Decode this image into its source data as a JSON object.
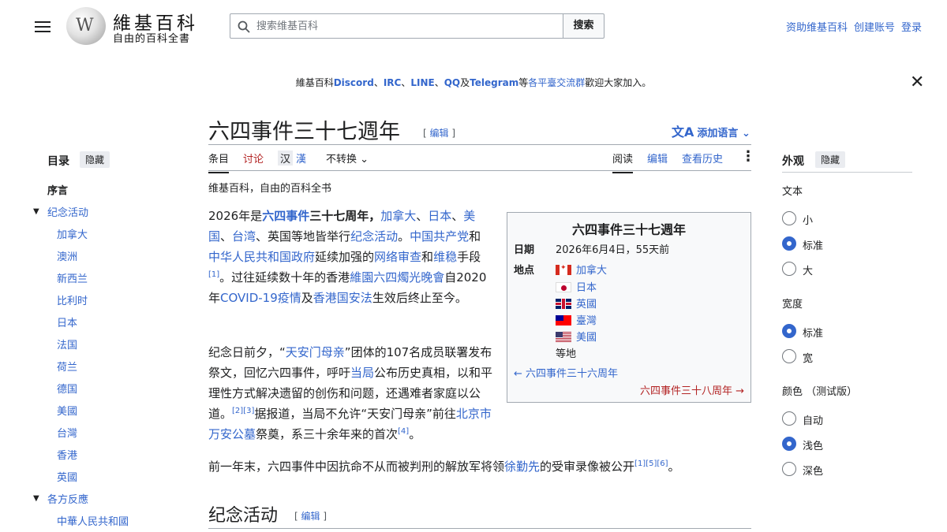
{
  "header": {
    "wordmark": "維基百科",
    "tagline": "自由的百科全書",
    "search_placeholder": "搜索维基百科",
    "search_button": "搜索",
    "user_links": [
      "资助维基百科",
      "创建账号",
      "登录"
    ]
  },
  "banner": {
    "prefix": "維基百科",
    "links": [
      "Discord",
      "IRC",
      "LINE",
      "QQ",
      "Telegram"
    ],
    "sep": "、",
    "and": "及",
    "mid": "等",
    "group_link": "各平臺交流群",
    "suffix": "歡迎大家加入。"
  },
  "page": {
    "title": "六四事件三十七週年",
    "edit_label": "编辑",
    "lang_button": "添加语言",
    "tabs_left": [
      "条目",
      "讨论"
    ],
    "variant_a": "汉",
    "variant_b": "漢",
    "no_convert": "不转换",
    "tabs_right": [
      "阅读",
      "编辑",
      "查看历史"
    ],
    "subtitle": "维基百科，自由的百科全书"
  },
  "toc": {
    "heading": "目录",
    "hide": "隐藏",
    "intro": "序言",
    "section1": "纪念活动",
    "section1_items": [
      "加拿大",
      "澳洲",
      "新西兰",
      "比利时",
      "日本",
      "法国",
      "荷兰",
      "德国",
      "美國",
      "台灣",
      "香港",
      "英國"
    ],
    "section2": "各方反應",
    "section2_items": [
      "中華人民共和國"
    ]
  },
  "para1": {
    "t1": "2026年是",
    "l1": "六四事件",
    "t2": "三十七周年，",
    "l2": "加拿大",
    "s1": "、",
    "l3": "日本",
    "s2": "、",
    "l4": "美国",
    "s3": "、",
    "l5": "台湾",
    "t3": "、英国等地皆举行",
    "l6": "纪念活动",
    "t4": "。",
    "l7": "中国共产党",
    "t5": "和",
    "l8": "中华人民共和国政府",
    "t6": "延续加强的",
    "l9": "网络审查",
    "t7": "和",
    "l10": "维稳",
    "t8": "手段",
    "ref1": "[1]",
    "t9": "。过往延续数十年的香港",
    "l11": "維園六四燭光晚會",
    "t10": "自2020年",
    "l12": "COVID-19疫情",
    "t11": "及",
    "l13": "香港国安法",
    "t12": "生效后终止至今。"
  },
  "para2": {
    "t1": "纪念日前夕，“",
    "l1": "天安门母亲",
    "t2": "”团体的107名成员联署发布祭文，回忆六四事件，呼吁",
    "l2": "当局",
    "t3": "公布历史真相，以和平理性方式解决遗留的创伤和问题，还遇难者家庭以公道。",
    "ref1": "[2]",
    "ref2": "[3]",
    "t4": "据报道，当局不允许“天安门母亲”前往",
    "l3": "北京市万安公墓",
    "t5": "祭奠，系三十余年来的首次",
    "ref3": "[4]",
    "t6": "。"
  },
  "para3": {
    "t1": "前一年末，六四事件中因抗命不从而被判刑的解放军将领",
    "l1": "徐勤先",
    "t2": "的受审录像被公开",
    "refs": "[1][5][6]",
    "t3": "。"
  },
  "infobox": {
    "title": "六四事件三十七週年",
    "date_label": "日期",
    "date_value": "2026年6月4日，55天前",
    "place_label": "地点",
    "places": [
      "加拿大",
      "日本",
      "英國",
      "臺灣",
      "美國"
    ],
    "etc": "等地",
    "prev": "← 六四事件三十六周年",
    "next": "六四事件三十八周年 →"
  },
  "section2": {
    "title": "纪念活动",
    "edit": "编辑"
  },
  "appearance": {
    "heading": "外观",
    "hide": "隐藏",
    "text_label": "文本",
    "text_options": [
      "小",
      "标准",
      "大"
    ],
    "text_selected": 1,
    "width_label": "宽度",
    "width_options": [
      "标准",
      "宽"
    ],
    "width_selected": 0,
    "color_label": "颜色 （测试版）",
    "color_options": [
      "自动",
      "浅色",
      "深色"
    ],
    "color_selected": 1
  },
  "colors": {
    "link": "#3366cc",
    "accent": "#3366cc",
    "redlink": "#b32424",
    "border": "#a2a9b1"
  }
}
